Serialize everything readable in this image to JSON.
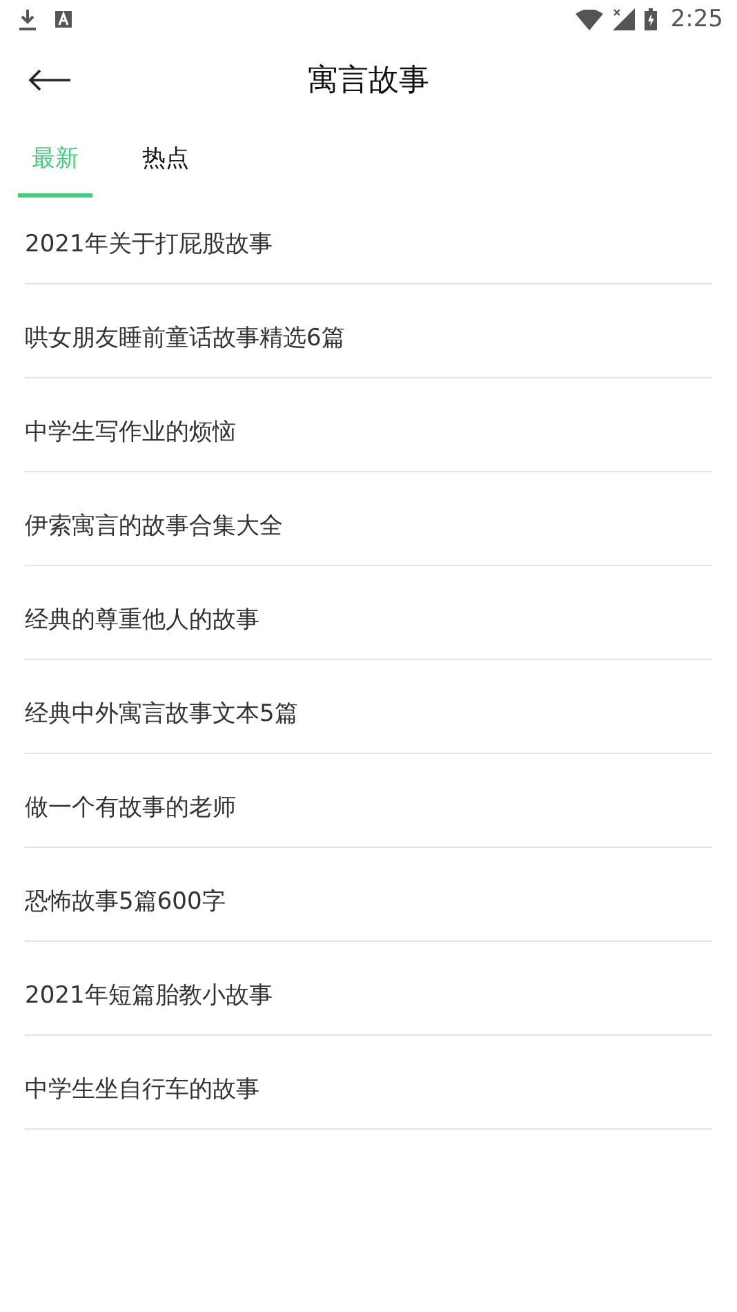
{
  "status_bar": {
    "time": "2:25"
  },
  "header": {
    "title": "寓言故事"
  },
  "tabs": [
    {
      "label": "最新",
      "selected": true
    },
    {
      "label": "热点",
      "selected": false
    }
  ],
  "articles": [
    "2021年关于打屁股故事",
    "哄女朋友睡前童话故事精选6篇",
    "中学生写作业的烦恼",
    "伊索寓言的故事合集大全",
    "经典的尊重他人的故事",
    "经典中外寓言故事文本5篇",
    "做一个有故事的老师",
    "恐怖故事5篇600字",
    "2021年短篇胎教小故事",
    "中学生坐自行车的故事"
  ]
}
